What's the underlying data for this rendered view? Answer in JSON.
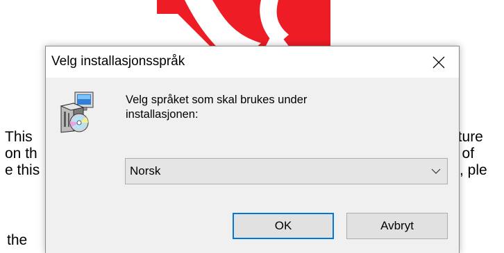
{
  "background": {
    "left_lines": [
      "This",
      "on th",
      "e this"
    ],
    "right_lines": [
      "ature",
      "n of",
      "K, ple"
    ],
    "bottom_line": "the",
    "logo_color": "#ee1c25"
  },
  "dialog": {
    "title": "Velg installasjonsspråk",
    "close_icon": "close-icon",
    "setup_icon": "setup-installer-icon",
    "message_line1": "Velg språket som skal brukes under",
    "message_line2": "installasjonen:",
    "language_select": {
      "selected": "Norsk"
    },
    "ok_label": "OK",
    "cancel_label": "Avbryt",
    "accent_color": "#0078d7"
  }
}
